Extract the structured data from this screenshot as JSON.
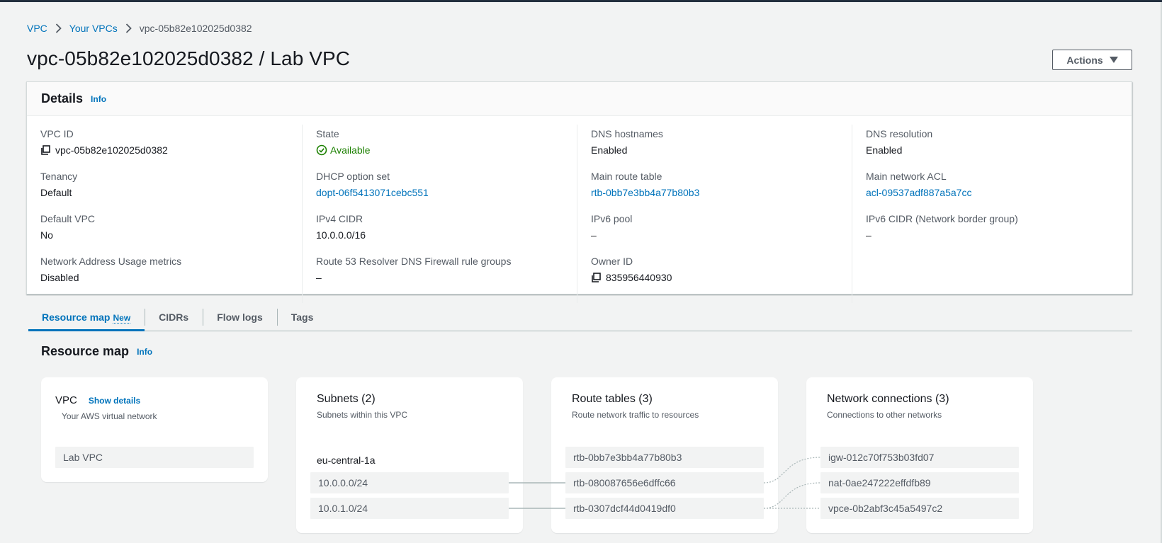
{
  "breadcrumb": [
    {
      "label": "VPC"
    },
    {
      "label": "Your VPCs"
    },
    {
      "label": "vpc-05b82e102025d0382"
    }
  ],
  "page": {
    "title": "vpc-05b82e102025d0382 / Lab VPC",
    "actions_label": "Actions"
  },
  "details": {
    "title": "Details",
    "info": "Info",
    "columns": [
      [
        {
          "label": "VPC ID",
          "value": "vpc-05b82e102025d0382"
        },
        {
          "label": "Tenancy",
          "value": "Default"
        },
        {
          "label": "Default VPC",
          "value": "No"
        },
        {
          "label": "Network Address Usage metrics",
          "value": "Disabled"
        }
      ],
      [
        {
          "label": "State",
          "value": "Available"
        },
        {
          "label": "DHCP option set",
          "value": "dopt-06f5413071cebc551"
        },
        {
          "label": "IPv4 CIDR",
          "value": "10.0.0.0/16"
        },
        {
          "label": "Route 53 Resolver DNS Firewall rule groups",
          "value": "–"
        }
      ],
      [
        {
          "label": "DNS hostnames",
          "value": "Enabled"
        },
        {
          "label": "Main route table",
          "value": "rtb-0bb7e3bb4a77b80b3"
        },
        {
          "label": "IPv6 pool",
          "value": "–"
        },
        {
          "label": "Owner ID",
          "value": "835956440930"
        }
      ],
      [
        {
          "label": "DNS resolution",
          "value": "Enabled"
        },
        {
          "label": "Main network ACL",
          "value": "acl-09537adf887a5a7cc"
        },
        {
          "label": "IPv6 CIDR (Network border group)",
          "value": "–"
        }
      ]
    ]
  },
  "tabs": [
    {
      "label": "Resource map",
      "badge": "New"
    },
    {
      "label": "CIDRs"
    },
    {
      "label": "Flow logs"
    },
    {
      "label": "Tags"
    }
  ],
  "resource_map": {
    "title": "Resource map",
    "info": "Info",
    "vpc": {
      "title": "VPC",
      "show_details": "Show details",
      "subtitle": "Your AWS virtual network",
      "items": [
        "Lab VPC"
      ]
    },
    "subnets": {
      "title": "Subnets (2)",
      "subtitle": "Subnets within this VPC",
      "az": "eu-central-1a",
      "items": [
        "10.0.0.0/24",
        "10.0.1.0/24"
      ]
    },
    "route_tables": {
      "title": "Route tables (3)",
      "subtitle": "Route network traffic to resources",
      "items": [
        "rtb-0bb7e3bb4a77b80b3",
        "rtb-080087656e6dffc66",
        "rtb-0307dcf44d0419df0"
      ]
    },
    "network_connections": {
      "title": "Network connections (3)",
      "subtitle": "Connections to other networks",
      "items": [
        "igw-012c70f753b03fd07",
        "nat-0ae247222effdfb89",
        "vpce-0b2abf3c45a5497c2"
      ]
    }
  },
  "colors": {
    "link": "#0073bb",
    "success": "#1d8102",
    "background": "#f2f3f3",
    "header_bar": "#232f3e"
  }
}
